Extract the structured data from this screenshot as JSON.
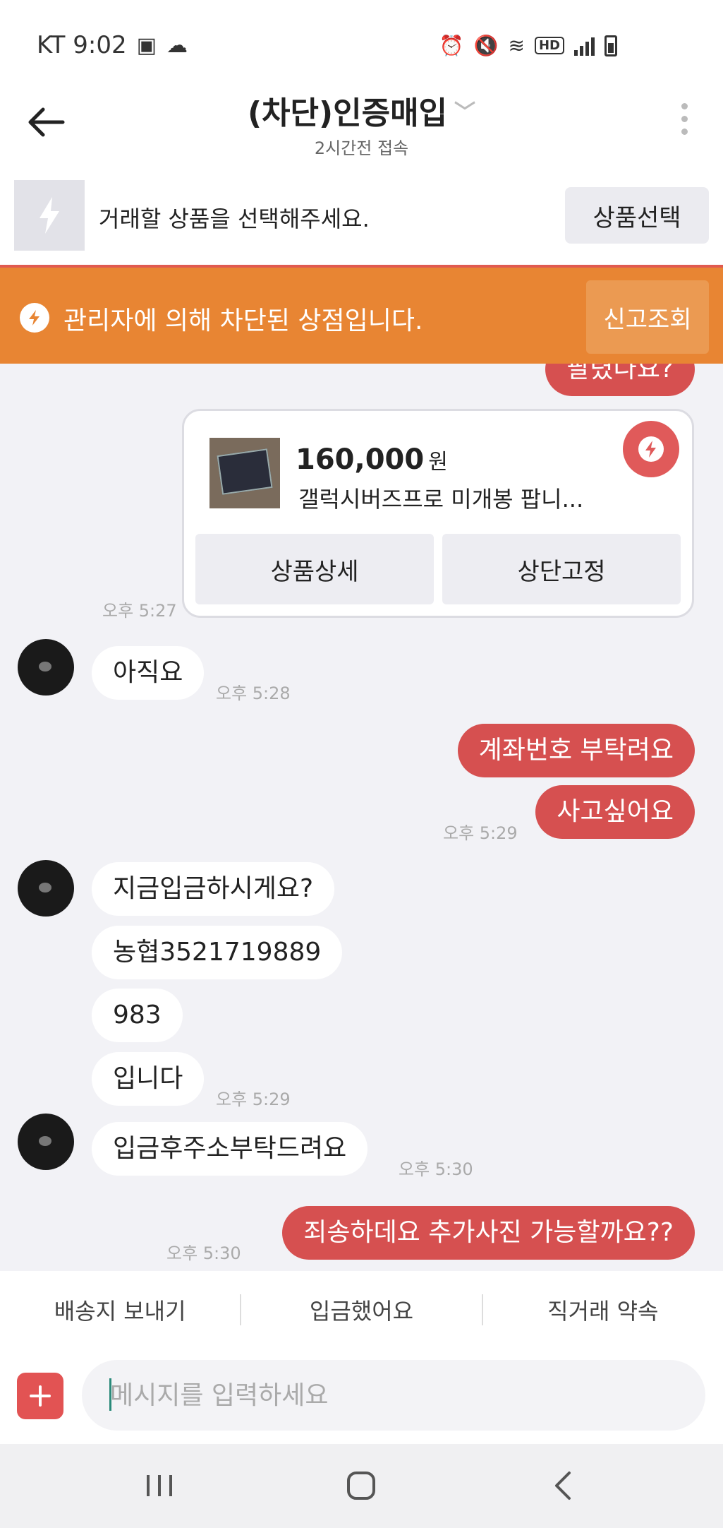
{
  "status_bar": {
    "carrier_time": "KT 9:02",
    "network_badge": "HD"
  },
  "header": {
    "title": "(차단)인증매입",
    "subtitle": "2시간전 접속"
  },
  "product_bar": {
    "prompt": "거래할 상품을 선택해주세요.",
    "select_label": "상품선택"
  },
  "block_banner": {
    "message": "관리자에 의해 차단된 상점입니다.",
    "report_label": "신고조회"
  },
  "chat": {
    "partial_top_message": "팔렸나요?",
    "product_card": {
      "price": "160,000",
      "currency": "원",
      "name": "갤럭시버즈프로 미개봉 팝니...",
      "detail_label": "상품상세",
      "pin_label": "상단고정",
      "time": "오후 5:27"
    },
    "messages": [
      {
        "from": "them",
        "text": "아직요",
        "time": "오후 5:28"
      },
      {
        "from": "me",
        "text": "계좌번호 부탁려요"
      },
      {
        "from": "me",
        "text": "사고싶어요",
        "time": "오후 5:29"
      },
      {
        "from": "them",
        "text": "지금입금하시게요?"
      },
      {
        "from": "them",
        "text": "농협3521719889"
      },
      {
        "from": "them",
        "text": "983"
      },
      {
        "from": "them",
        "text": "입니다",
        "time": "오후 5:29"
      },
      {
        "from": "them",
        "text": "입금후주소부탁드려요",
        "time": "오후 5:30"
      },
      {
        "from": "me",
        "text": "죄송하데요 추가사진 가능할까요??",
        "time": "오후 5:30"
      }
    ]
  },
  "quick_replies": [
    "배송지 보내기",
    "입금했어요",
    "직거래 약속"
  ],
  "composer": {
    "placeholder": "메시지를 입력하세요",
    "value": ""
  },
  "colors": {
    "accent_red": "#d65050",
    "banner_orange": "#e88533",
    "chat_background": "#f2f2f6"
  },
  "icons": [
    "back-arrow-icon",
    "chevron-down-icon",
    "more-vert-icon",
    "bolt-icon",
    "warning-bolt-icon",
    "plus-icon",
    "recent-apps-icon",
    "home-icon",
    "nav-back-icon"
  ]
}
